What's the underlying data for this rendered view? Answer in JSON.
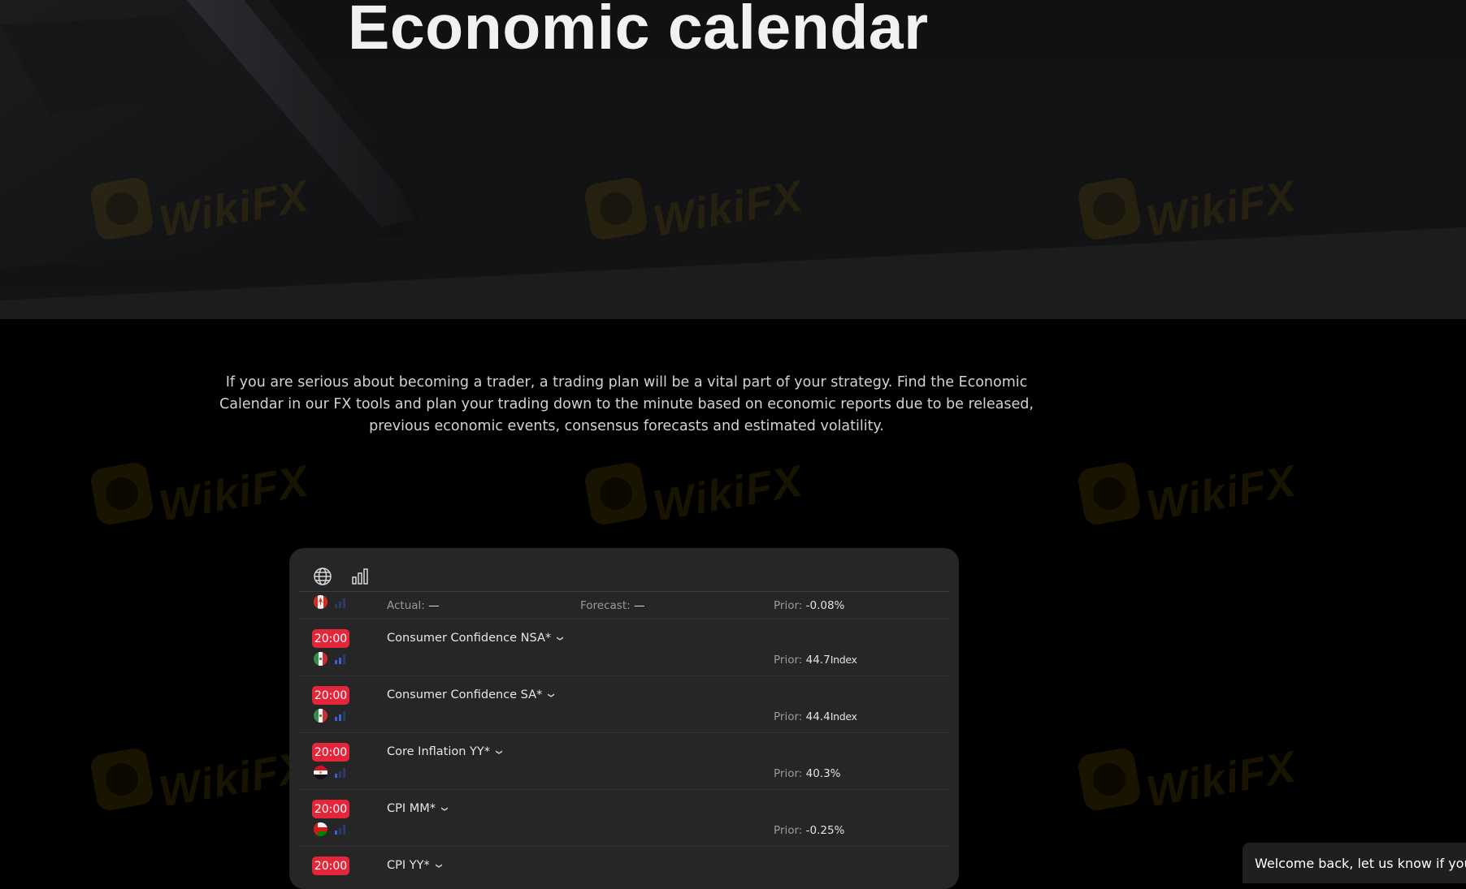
{
  "hero": {
    "title": "Economic calendar"
  },
  "intro": {
    "text": "If you are serious about becoming a trader, a trading plan will be a vital part of your strategy. Find the Economic Calendar in our FX tools and plan your trading down to the minute based on economic reports due to be released, previous economic events, consensus forecasts and estimated volatility."
  },
  "watermark": {
    "text": "WikiFX"
  },
  "calendar": {
    "tools": [
      {
        "icon": "globe-icon"
      },
      {
        "icon": "bar-chart-icon"
      }
    ],
    "first_row": {
      "actual_label": "Actual:",
      "actual_value": "—",
      "forecast_label": "Forecast:",
      "forecast_value": "—",
      "prior_label": "Prior:",
      "prior_value": "-0.08%"
    },
    "events": [
      {
        "time": "20:00",
        "name": "Consumer Confidence NSA*",
        "prior_label": "Prior:",
        "prior_value": "44.7",
        "prior_unit": "Index",
        "flag": "mexico"
      },
      {
        "time": "20:00",
        "name": "Consumer Confidence SA*",
        "prior_label": "Prior:",
        "prior_value": "44.4",
        "prior_unit": "Index",
        "flag": "mexico"
      },
      {
        "time": "20:00",
        "name": "Core Inflation YY*",
        "prior_label": "Prior:",
        "prior_value": "40.3%",
        "prior_unit": "",
        "flag": "egypt"
      },
      {
        "time": "20:00",
        "name": "CPI MM*",
        "prior_label": "Prior:",
        "prior_value": "-0.25%",
        "prior_unit": "",
        "flag": "oman"
      },
      {
        "time": "20:00",
        "name": "CPI YY*",
        "prior_label": "",
        "prior_value": "",
        "prior_unit": "",
        "flag": "oman"
      }
    ],
    "colors": {
      "time_badge": "#e5263a",
      "impact_active": "#3a62d6",
      "impact_inactive": "#2b3a66"
    }
  },
  "chat": {
    "text": "Welcome back, let us know if you"
  }
}
